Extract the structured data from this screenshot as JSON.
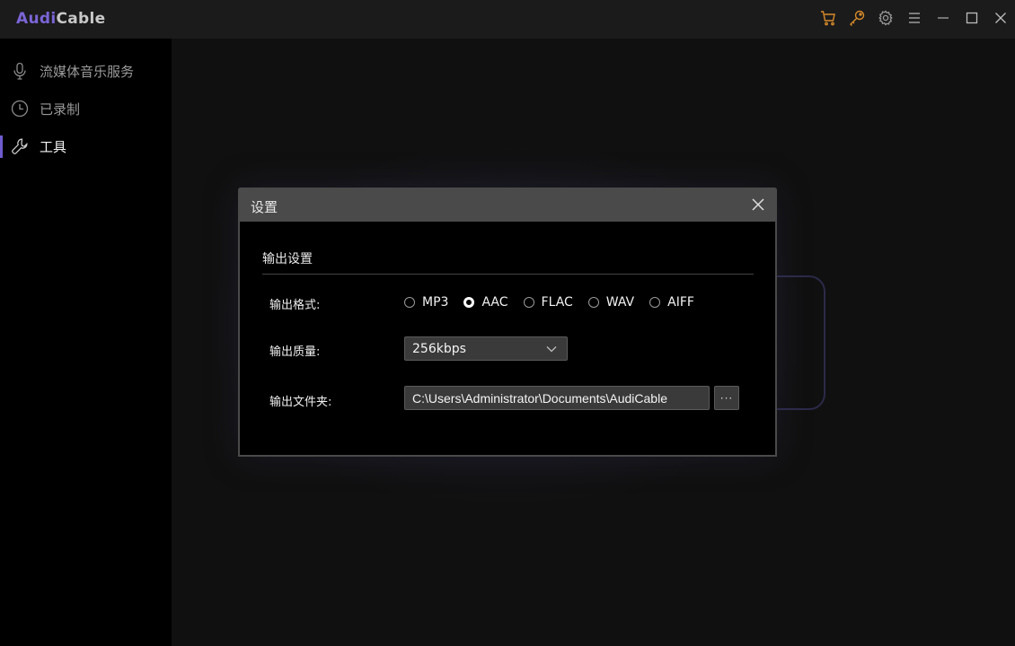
{
  "app": {
    "logo_part1": "Audi",
    "logo_part2": "Cable",
    "accent_color": "#7b65d6",
    "icon_color": "#d98b2b"
  },
  "titlebar": {
    "icons": [
      "cart-icon",
      "key-icon",
      "gear-icon",
      "menu-icon",
      "minimize-icon",
      "maximize-icon",
      "close-icon"
    ]
  },
  "sidebar": {
    "items": [
      {
        "label": "流媒体音乐服务",
        "icon": "microphone-icon",
        "active": false
      },
      {
        "label": "已录制",
        "icon": "clock-icon",
        "active": false
      },
      {
        "label": "工具",
        "icon": "wrench-icon",
        "active": true
      }
    ]
  },
  "dialog": {
    "title": "设置",
    "section_title": "输出设置",
    "format_label": "输出格式:",
    "formats": [
      {
        "label": "MP3",
        "checked": false
      },
      {
        "label": "AAC",
        "checked": true
      },
      {
        "label": "FLAC",
        "checked": false
      },
      {
        "label": "WAV",
        "checked": false
      },
      {
        "label": "AIFF",
        "checked": false
      }
    ],
    "quality_label": "输出质量:",
    "quality_value": "256kbps",
    "folder_label": "输出文件夹:",
    "folder_value": "C:\\Users\\Administrator\\Documents\\AudiCable",
    "browse_label": "···"
  }
}
